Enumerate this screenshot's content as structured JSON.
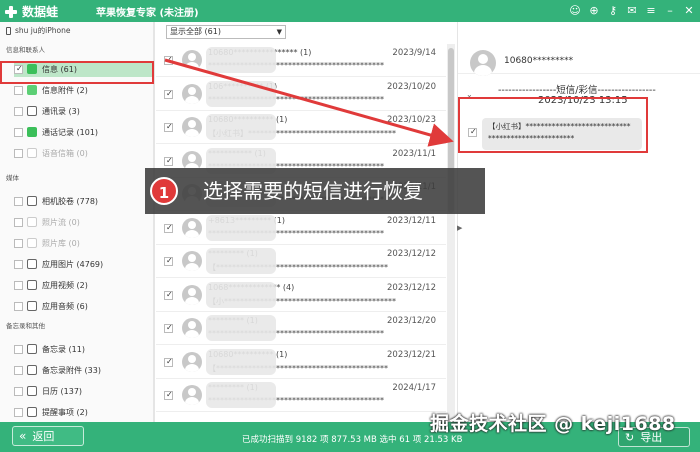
{
  "app": {
    "logo_text": "数据蛙",
    "title": "苹果恢复专家 (未注册)",
    "titlebar_icons": [
      "user-icon",
      "cart-icon",
      "key-icon",
      "chat-icon",
      "menu-icon",
      "minimize-icon",
      "close-icon"
    ]
  },
  "sidebar": {
    "device": "shu ju的iPhone",
    "sections": [
      {
        "title": "信息和联系人",
        "items": [
          {
            "label": "信息 (61)",
            "icon": "message-icon",
            "checked": true,
            "selected": true,
            "disabled": false
          },
          {
            "label": "信息附件 (2)",
            "icon": "attachment-icon",
            "checked": false,
            "selected": false,
            "disabled": false
          },
          {
            "label": "通讯录 (3)",
            "icon": "contacts-icon",
            "checked": false,
            "selected": false,
            "disabled": false
          },
          {
            "label": "通话记录 (101)",
            "icon": "phone-icon",
            "checked": false,
            "selected": false,
            "disabled": false
          },
          {
            "label": "语音信箱 (0)",
            "icon": "voicemail-icon",
            "checked": false,
            "selected": false,
            "disabled": true
          }
        ]
      },
      {
        "title": "媒体",
        "items": [
          {
            "label": "相机胶卷 (778)",
            "icon": "camera-icon",
            "checked": false,
            "selected": false,
            "disabled": false
          },
          {
            "label": "照片流 (0)",
            "icon": "photostream-icon",
            "checked": false,
            "selected": false,
            "disabled": true
          },
          {
            "label": "照片库 (0)",
            "icon": "photolibrary-icon",
            "checked": false,
            "selected": false,
            "disabled": true
          },
          {
            "label": "应用图片 (4769)",
            "icon": "image-icon",
            "checked": false,
            "selected": false,
            "disabled": false
          },
          {
            "label": "应用视频 (2)",
            "icon": "video-icon",
            "checked": false,
            "selected": false,
            "disabled": false
          },
          {
            "label": "应用音频 (6)",
            "icon": "audio-icon",
            "checked": false,
            "selected": false,
            "disabled": false
          }
        ]
      },
      {
        "title": "备忘录和其他",
        "items": [
          {
            "label": "备忘录 (11)",
            "icon": "notes-icon",
            "checked": false,
            "selected": false,
            "disabled": false
          },
          {
            "label": "备忘录附件 (33)",
            "icon": "notes-attachment-icon",
            "checked": false,
            "selected": false,
            "disabled": false
          },
          {
            "label": "日历 (137)",
            "icon": "calendar-icon",
            "checked": false,
            "selected": false,
            "disabled": false
          },
          {
            "label": "提醒事项 (2)",
            "icon": "reminder-icon",
            "checked": false,
            "selected": false,
            "disabled": false
          }
        ]
      }
    ]
  },
  "list": {
    "filter_value": "显示全部 (61)",
    "rows": [
      {
        "num": "10680**************** (1)",
        "date": "2023/9/14",
        "body": "********************************************"
      },
      {
        "num": "106********** (1)",
        "date": "2023/10/20",
        "body": "********************************************"
      },
      {
        "num": "10680********** (1)",
        "date": "2023/10/23",
        "body": "【小红书】*************************************"
      },
      {
        "num": "*********** (1)",
        "date": "2023/11/1",
        "body": "********************************************"
      },
      {
        "num": "********** (1)",
        "date": "2023/11/1",
        "body": "********************************************"
      },
      {
        "num": "+8613********* (1)",
        "date": "2023/12/11",
        "body": "********************************************"
      },
      {
        "num": "********* (1)",
        "date": "2023/12/12",
        "body": "【*******************************************"
      },
      {
        "num": "1068************* (4)",
        "date": "2023/12/12",
        "body": "【小*******************************************"
      },
      {
        "num": "********* (1)",
        "date": "2023/12/20",
        "body": "********************************************"
      },
      {
        "num": "10680********** (1)",
        "date": "2023/12/21",
        "body": "【*******************************************"
      },
      {
        "num": "********* (1)",
        "date": "2024/1/17",
        "body": "********************************************"
      }
    ]
  },
  "detail": {
    "contact": "10680*********",
    "separator": "-----------------短信/彩信-----------------",
    "date": "2023/10/23 13:15",
    "bubble_line1": "【小红书】****************************",
    "bubble_line2": "***********************"
  },
  "callout": {
    "badge": "1",
    "text": "选择需要的短信进行恢复"
  },
  "footer": {
    "back_label": "返回",
    "status": "已成功扫描到 9182 项 877.53 MB  选中 61 项 21.53 KB",
    "export_label": "导出",
    "watermark": "掘金技术社区 @ keji1688"
  },
  "colors": {
    "brand_green": "#34b27a",
    "highlight_red": "#e03a3a",
    "selected_bg": "#bde6c8"
  }
}
